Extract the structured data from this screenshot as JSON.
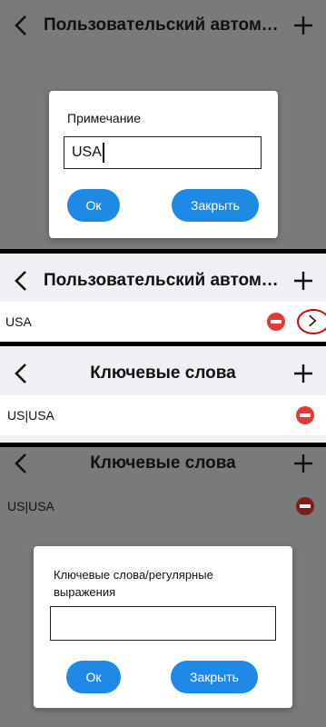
{
  "panel1": {
    "title": "Пользовательский автоматиче...",
    "dialog_title": "Примечание",
    "input_value": "USA",
    "ok_label": "Ок",
    "close_label": "Закрыть"
  },
  "panel2": {
    "title": "Пользовательский автоматиче...",
    "rows": [
      {
        "label": "USA"
      }
    ]
  },
  "panel3": {
    "title": "Ключевые слова",
    "rows": [
      {
        "label": "US|USA"
      }
    ]
  },
  "panel4": {
    "title": "Ключевые слова",
    "rows": [
      {
        "label": "US|USA"
      }
    ],
    "dialog_title": "Ключевые слова/регулярные выражения",
    "input_value": "",
    "ok_label": "Ок",
    "close_label": "Закрыть"
  },
  "colors": {
    "accent": "#1f8ae6",
    "delete": "#e53935",
    "highlight_circle": "#d90000",
    "header_bg": "#efeff4"
  },
  "icons": [
    "back-icon",
    "plus-icon",
    "minus-circle-icon",
    "chevron-right-icon"
  ]
}
